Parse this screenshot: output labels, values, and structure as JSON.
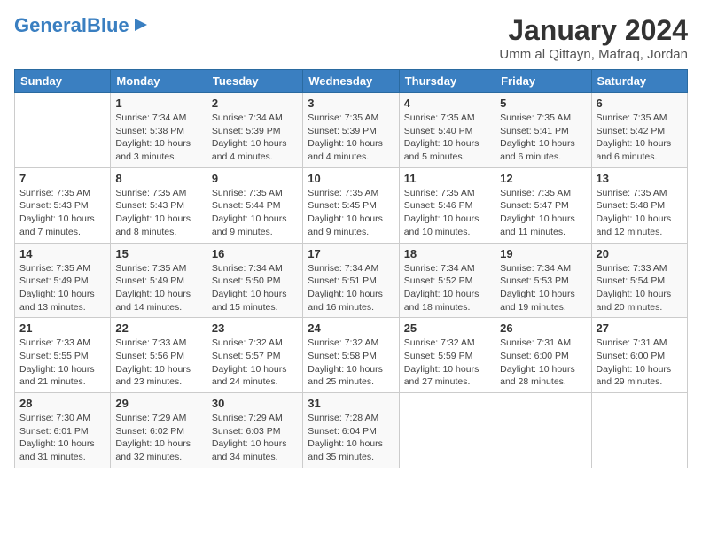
{
  "logo": {
    "text_part1": "General",
    "text_part2": "Blue"
  },
  "title": "January 2024",
  "location": "Umm al Qittayn, Mafraq, Jordan",
  "headers": [
    "Sunday",
    "Monday",
    "Tuesday",
    "Wednesday",
    "Thursday",
    "Friday",
    "Saturday"
  ],
  "weeks": [
    [
      {
        "day": "",
        "info": ""
      },
      {
        "day": "1",
        "info": "Sunrise: 7:34 AM\nSunset: 5:38 PM\nDaylight: 10 hours\nand 3 minutes."
      },
      {
        "day": "2",
        "info": "Sunrise: 7:34 AM\nSunset: 5:39 PM\nDaylight: 10 hours\nand 4 minutes."
      },
      {
        "day": "3",
        "info": "Sunrise: 7:35 AM\nSunset: 5:39 PM\nDaylight: 10 hours\nand 4 minutes."
      },
      {
        "day": "4",
        "info": "Sunrise: 7:35 AM\nSunset: 5:40 PM\nDaylight: 10 hours\nand 5 minutes."
      },
      {
        "day": "5",
        "info": "Sunrise: 7:35 AM\nSunset: 5:41 PM\nDaylight: 10 hours\nand 6 minutes."
      },
      {
        "day": "6",
        "info": "Sunrise: 7:35 AM\nSunset: 5:42 PM\nDaylight: 10 hours\nand 6 minutes."
      }
    ],
    [
      {
        "day": "7",
        "info": "Sunrise: 7:35 AM\nSunset: 5:43 PM\nDaylight: 10 hours\nand 7 minutes."
      },
      {
        "day": "8",
        "info": "Sunrise: 7:35 AM\nSunset: 5:43 PM\nDaylight: 10 hours\nand 8 minutes."
      },
      {
        "day": "9",
        "info": "Sunrise: 7:35 AM\nSunset: 5:44 PM\nDaylight: 10 hours\nand 9 minutes."
      },
      {
        "day": "10",
        "info": "Sunrise: 7:35 AM\nSunset: 5:45 PM\nDaylight: 10 hours\nand 9 minutes."
      },
      {
        "day": "11",
        "info": "Sunrise: 7:35 AM\nSunset: 5:46 PM\nDaylight: 10 hours\nand 10 minutes."
      },
      {
        "day": "12",
        "info": "Sunrise: 7:35 AM\nSunset: 5:47 PM\nDaylight: 10 hours\nand 11 minutes."
      },
      {
        "day": "13",
        "info": "Sunrise: 7:35 AM\nSunset: 5:48 PM\nDaylight: 10 hours\nand 12 minutes."
      }
    ],
    [
      {
        "day": "14",
        "info": "Sunrise: 7:35 AM\nSunset: 5:49 PM\nDaylight: 10 hours\nand 13 minutes."
      },
      {
        "day": "15",
        "info": "Sunrise: 7:35 AM\nSunset: 5:49 PM\nDaylight: 10 hours\nand 14 minutes."
      },
      {
        "day": "16",
        "info": "Sunrise: 7:34 AM\nSunset: 5:50 PM\nDaylight: 10 hours\nand 15 minutes."
      },
      {
        "day": "17",
        "info": "Sunrise: 7:34 AM\nSunset: 5:51 PM\nDaylight: 10 hours\nand 16 minutes."
      },
      {
        "day": "18",
        "info": "Sunrise: 7:34 AM\nSunset: 5:52 PM\nDaylight: 10 hours\nand 18 minutes."
      },
      {
        "day": "19",
        "info": "Sunrise: 7:34 AM\nSunset: 5:53 PM\nDaylight: 10 hours\nand 19 minutes."
      },
      {
        "day": "20",
        "info": "Sunrise: 7:33 AM\nSunset: 5:54 PM\nDaylight: 10 hours\nand 20 minutes."
      }
    ],
    [
      {
        "day": "21",
        "info": "Sunrise: 7:33 AM\nSunset: 5:55 PM\nDaylight: 10 hours\nand 21 minutes."
      },
      {
        "day": "22",
        "info": "Sunrise: 7:33 AM\nSunset: 5:56 PM\nDaylight: 10 hours\nand 23 minutes."
      },
      {
        "day": "23",
        "info": "Sunrise: 7:32 AM\nSunset: 5:57 PM\nDaylight: 10 hours\nand 24 minutes."
      },
      {
        "day": "24",
        "info": "Sunrise: 7:32 AM\nSunset: 5:58 PM\nDaylight: 10 hours\nand 25 minutes."
      },
      {
        "day": "25",
        "info": "Sunrise: 7:32 AM\nSunset: 5:59 PM\nDaylight: 10 hours\nand 27 minutes."
      },
      {
        "day": "26",
        "info": "Sunrise: 7:31 AM\nSunset: 6:00 PM\nDaylight: 10 hours\nand 28 minutes."
      },
      {
        "day": "27",
        "info": "Sunrise: 7:31 AM\nSunset: 6:00 PM\nDaylight: 10 hours\nand 29 minutes."
      }
    ],
    [
      {
        "day": "28",
        "info": "Sunrise: 7:30 AM\nSunset: 6:01 PM\nDaylight: 10 hours\nand 31 minutes."
      },
      {
        "day": "29",
        "info": "Sunrise: 7:29 AM\nSunset: 6:02 PM\nDaylight: 10 hours\nand 32 minutes."
      },
      {
        "day": "30",
        "info": "Sunrise: 7:29 AM\nSunset: 6:03 PM\nDaylight: 10 hours\nand 34 minutes."
      },
      {
        "day": "31",
        "info": "Sunrise: 7:28 AM\nSunset: 6:04 PM\nDaylight: 10 hours\nand 35 minutes."
      },
      {
        "day": "",
        "info": ""
      },
      {
        "day": "",
        "info": ""
      },
      {
        "day": "",
        "info": ""
      }
    ]
  ]
}
